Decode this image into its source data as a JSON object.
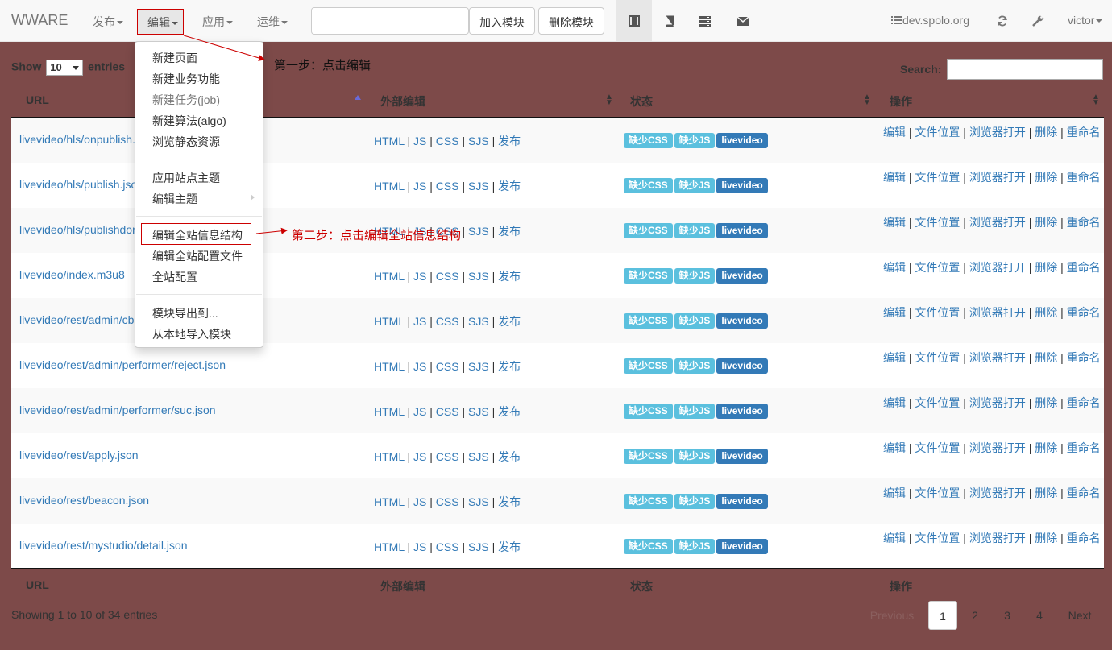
{
  "navbar": {
    "brand": "WWARE",
    "menus": [
      {
        "label": "发布"
      },
      {
        "label": "编辑"
      },
      {
        "label": "应用"
      },
      {
        "label": "运维"
      }
    ],
    "search_value": "",
    "buttons": {
      "add": "加入模块",
      "remove": "删除模块"
    },
    "icons": [
      "film-icon",
      "book-icon",
      "server-icon",
      "envelope-icon"
    ],
    "domain": "dev.spolo.org",
    "user": "victor"
  },
  "dropdown": {
    "group1": [
      "新建页面",
      "新建业务功能",
      "新建任务(job)",
      "新建算法(algo)",
      "浏览静态资源"
    ],
    "group2": [
      "应用站点主题",
      "编辑主题"
    ],
    "group3": [
      "编辑全站信息结构",
      "编辑全站配置文件",
      "全站配置"
    ],
    "group4": [
      "模块导出到...",
      "从本地导入模块"
    ]
  },
  "annotations": {
    "step1": "第一步：点击编辑",
    "step2": "第二步：点击编辑全站信息结构"
  },
  "table": {
    "show_prefix": "Show",
    "show_value": "10",
    "show_suffix": "entries",
    "search_label": "Search:",
    "headers": [
      "URL",
      "外部编辑",
      "状态",
      "操作"
    ],
    "rows": [
      "livevideo/hls/onpublish.json",
      "livevideo/hls/publish.json",
      "livevideo/hls/publishdone.json",
      "livevideo/index.m3u8",
      "livevideo/rest/admin/cb.json",
      "livevideo/rest/admin/performer/reject.json",
      "livevideo/rest/admin/performer/suc.json",
      "livevideo/rest/apply.json",
      "livevideo/rest/beacon.json",
      "livevideo/rest/mystudio/detail.json"
    ],
    "edit_links": [
      "HTML",
      "JS",
      "CSS",
      "SJS",
      "发布"
    ],
    "badges": [
      "缺少CSS",
      "缺少JS",
      "livevideo"
    ],
    "ops": [
      "编辑",
      "文件位置",
      "浏览器打开",
      "删除",
      "重命名"
    ],
    "info": "Showing 1 to 10 of 34 entries",
    "pagination": [
      "Previous",
      "1",
      "2",
      "3",
      "4",
      "Next"
    ]
  },
  "colors": {
    "background": "#7d4a49",
    "link": "#337ab7",
    "badge_info": "#5bc0de",
    "badge_primary": "#337ab7",
    "annotation": "#cc0000"
  }
}
